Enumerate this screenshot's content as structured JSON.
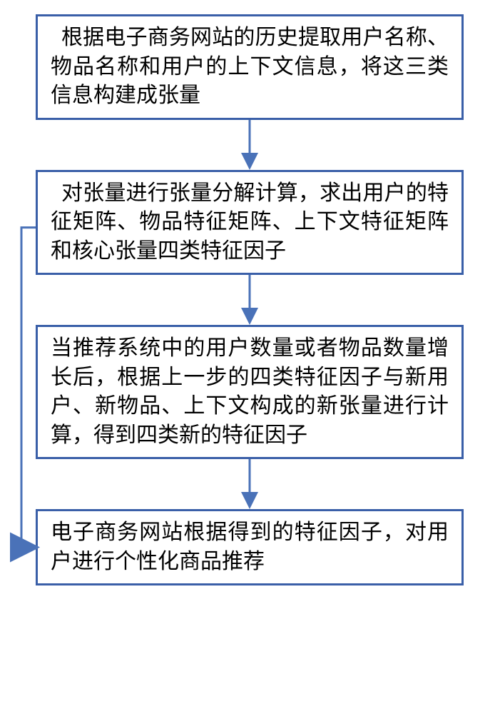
{
  "flow": {
    "step1": "根据电子商务网站的历史提取用户名称、物品名称和用户的上下文信息，将这三类信息构建成张量",
    "step2": "对张量进行张量分解计算，求出用户的特征矩阵、物品特征矩阵、上下文特征矩阵和核心张量四类特征因子",
    "step3": "当推荐系统中的用户数量或者物品数量增长后，根据上一步的四类特征因子与新用户、新物品、上下文构成的新张量进行计算，得到四类新的特征因子",
    "step4": "电子商务网站根据得到的特征因子，对用户进行个性化商品推荐"
  },
  "arrows": {
    "a12": "step1-to-step2",
    "a23": "step2-to-step3",
    "a34": "step3-to-step4",
    "a24": "step2-to-step4-side"
  },
  "colors": {
    "border": "#3a5fa8",
    "arrow": "#4a72b8"
  }
}
